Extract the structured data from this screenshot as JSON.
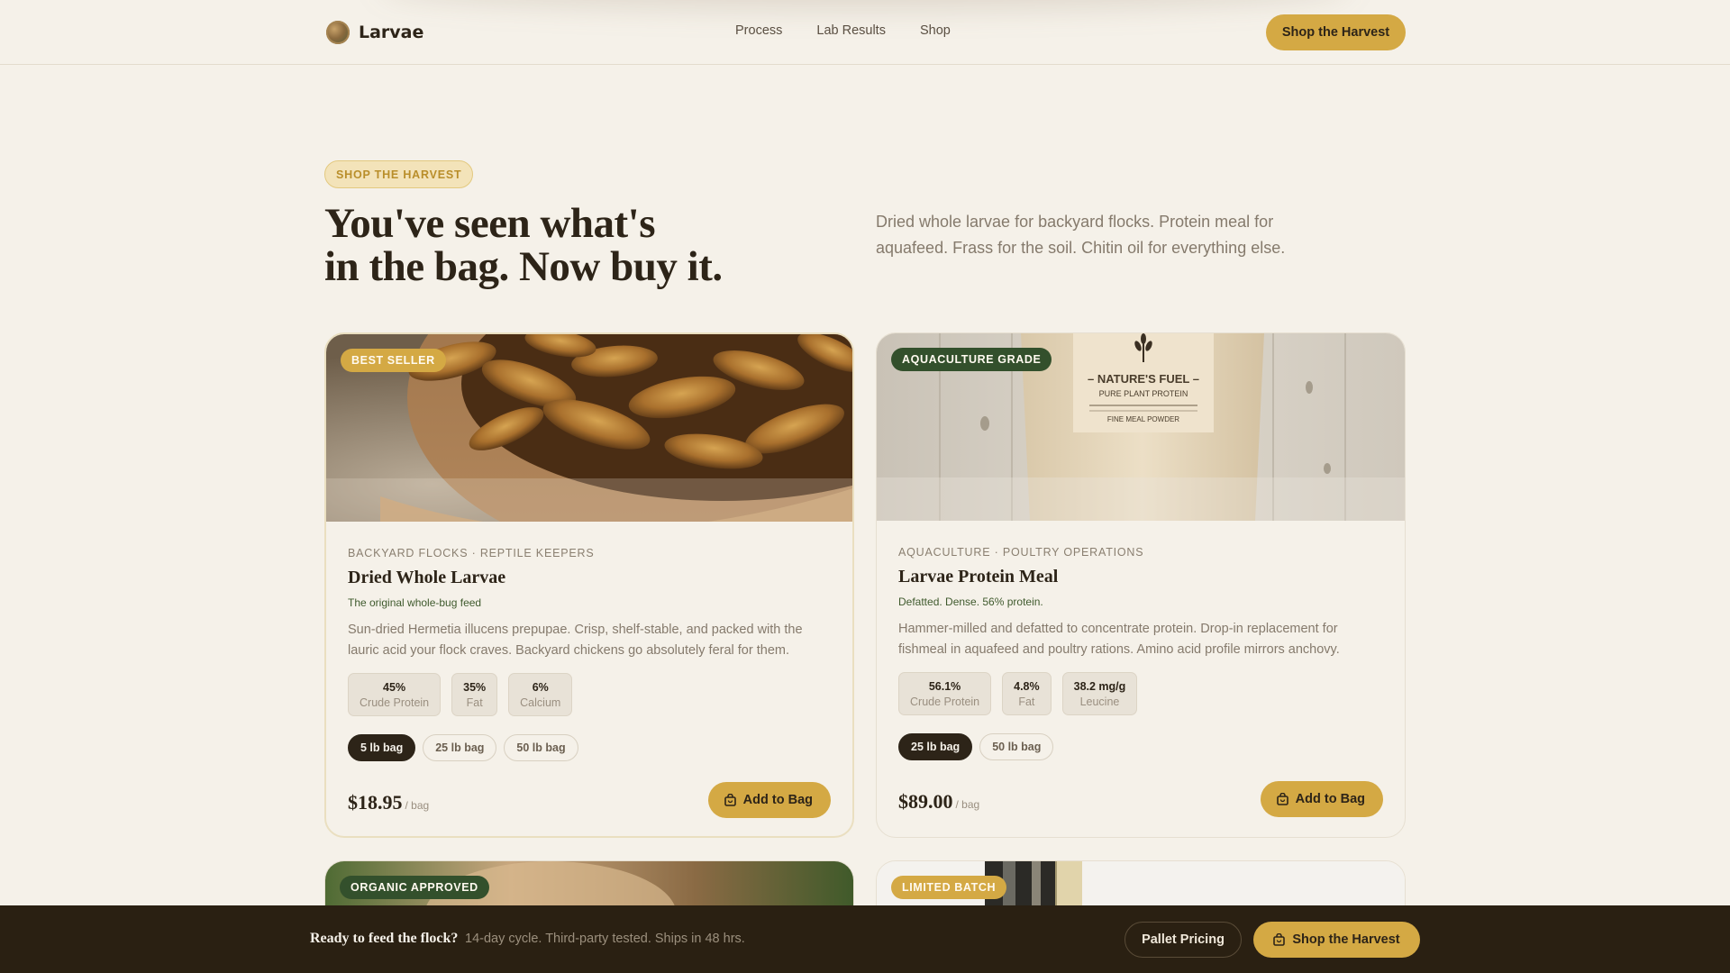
{
  "nav": {
    "brand": "Larvae",
    "links": [
      "Process",
      "Lab Results",
      "Shop"
    ],
    "cta": "Shop the Harvest"
  },
  "hero": {
    "eyebrow": "SHOP THE HARVEST",
    "title_line1": "You've seen what's",
    "title_line2": "in the bag. Now buy it.",
    "description": "Dried whole larvae for backyard flocks. Protein meal for aquafeed. Frass for the soil. Chitin oil for everything else."
  },
  "products": [
    {
      "badge": "BEST SELLER",
      "kicker": "BACKYARD FLOCKS · REPTILE KEEPERS",
      "title": "Dried Whole Larvae",
      "tagline": "The original whole-bug feed",
      "description": "Sun-dried Hermetia illucens prepupae. Crisp, shelf-stable, and packed with the lauric acid your flock craves. Backyard chickens go absolutely feral for them.",
      "stats": [
        {
          "value": "45%",
          "label": "Crude Protein"
        },
        {
          "value": "35%",
          "label": "Fat"
        },
        {
          "value": "6%",
          "label": "Calcium"
        }
      ],
      "sizes": [
        "5 lb bag",
        "25 lb bag",
        "50 lb bag"
      ],
      "selected_size": "5 lb bag",
      "price": "$18.95",
      "unit": "/ bag",
      "button": "Add to Bag"
    },
    {
      "badge": "AQUACULTURE GRADE",
      "kicker": "AQUACULTURE · POULTRY OPERATIONS",
      "title": "Larvae Protein Meal",
      "tagline": "Defatted. Dense. 56% protein.",
      "description": "Hammer-milled and defatted to concentrate protein. Drop-in replacement for fishmeal in aquafeed and poultry rations. Amino acid profile mirrors anchovy.",
      "stats": [
        {
          "value": "56.1%",
          "label": "Crude Protein"
        },
        {
          "value": "4.8%",
          "label": "Fat"
        },
        {
          "value": "38.2 mg/g",
          "label": "Leucine"
        }
      ],
      "sizes": [
        "25 lb bag",
        "50 lb bag"
      ],
      "selected_size": "25 lb bag",
      "price": "$89.00",
      "unit": "/ bag",
      "button": "Add to Bag",
      "package_text": {
        "brand": "– NATURE'S FUEL –",
        "line": "PURE PLANT PROTEIN",
        "sub": "FINE MEAL POWDER"
      }
    },
    {
      "badge": "ORGANIC APPROVED"
    },
    {
      "badge": "LIMITED BATCH"
    }
  ],
  "sticky_bar": {
    "title": "Ready to feed the flock?",
    "subtitle": "14-day cycle. Third-party tested. Ships in 48 hrs.",
    "secondary": "Pallet Pricing",
    "cta": "Shop the Harvest"
  },
  "colors": {
    "background": "#f5f1e9",
    "accent_gold": "#d4a944",
    "dark": "#2d2418",
    "badge_green": "#33502c",
    "sticky_bar": "#2a2012"
  }
}
